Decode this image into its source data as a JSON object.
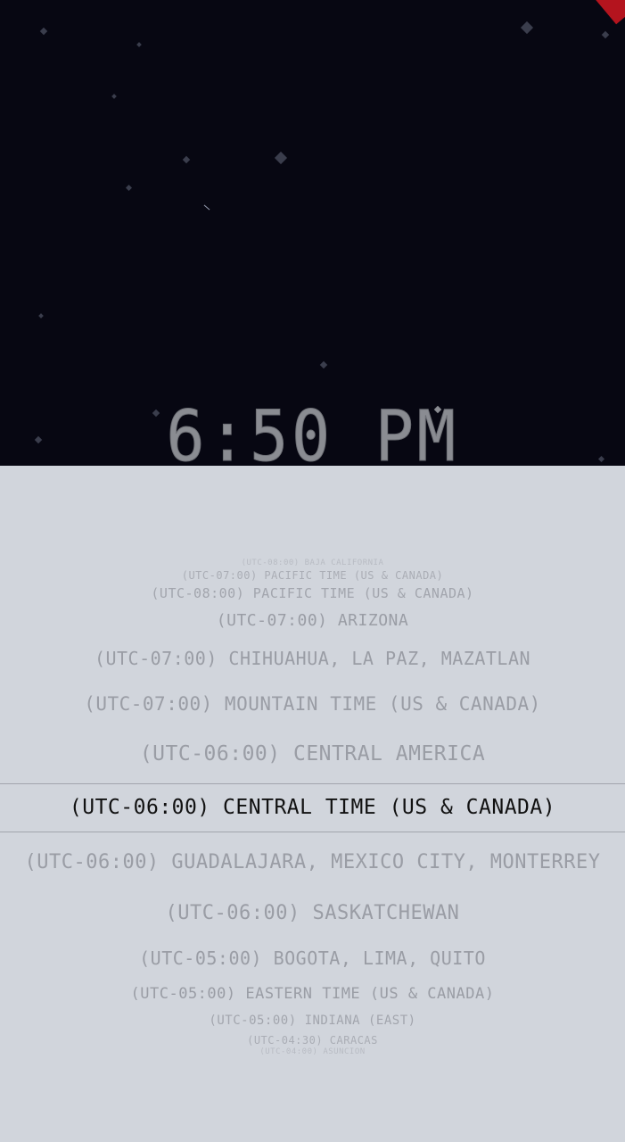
{
  "clock": {
    "time": "6:50 PM"
  },
  "colors": {
    "sky": "#070712",
    "picker_background": "#d1d5dc",
    "selected_text": "#111111",
    "unselected_text": "#9a9da5",
    "accent_corner": "#b4141e"
  },
  "timezones": [
    "(UTC-08:00) Baja California",
    "(UTC-07:00) Pacific Time (US & Canada)",
    "(UTC-08:00) Pacific Time (US & Canada)",
    "(UTC-07:00) Arizona",
    "(UTC-07:00) Chihuahua, La Paz, Mazatlan",
    "(UTC-07:00) Mountain Time (US & Canada)",
    "(UTC-06:00) Central America",
    "(UTC-06:00) Central Time (US & Canada)",
    "(UTC-06:00) Guadalajara, Mexico City, Monterrey",
    "(UTC-06:00) Saskatchewan",
    "(UTC-05:00) Bogota, Lima, Quito",
    "(UTC-05:00) Eastern Time (US & Canada)",
    "(UTC-05:00) Indiana (East)",
    "(UTC-04:30) Caracas",
    "(UTC-04:00) Asuncion"
  ],
  "selected_timezone": "(UTC-06:00) Central Time (US & Canada)"
}
